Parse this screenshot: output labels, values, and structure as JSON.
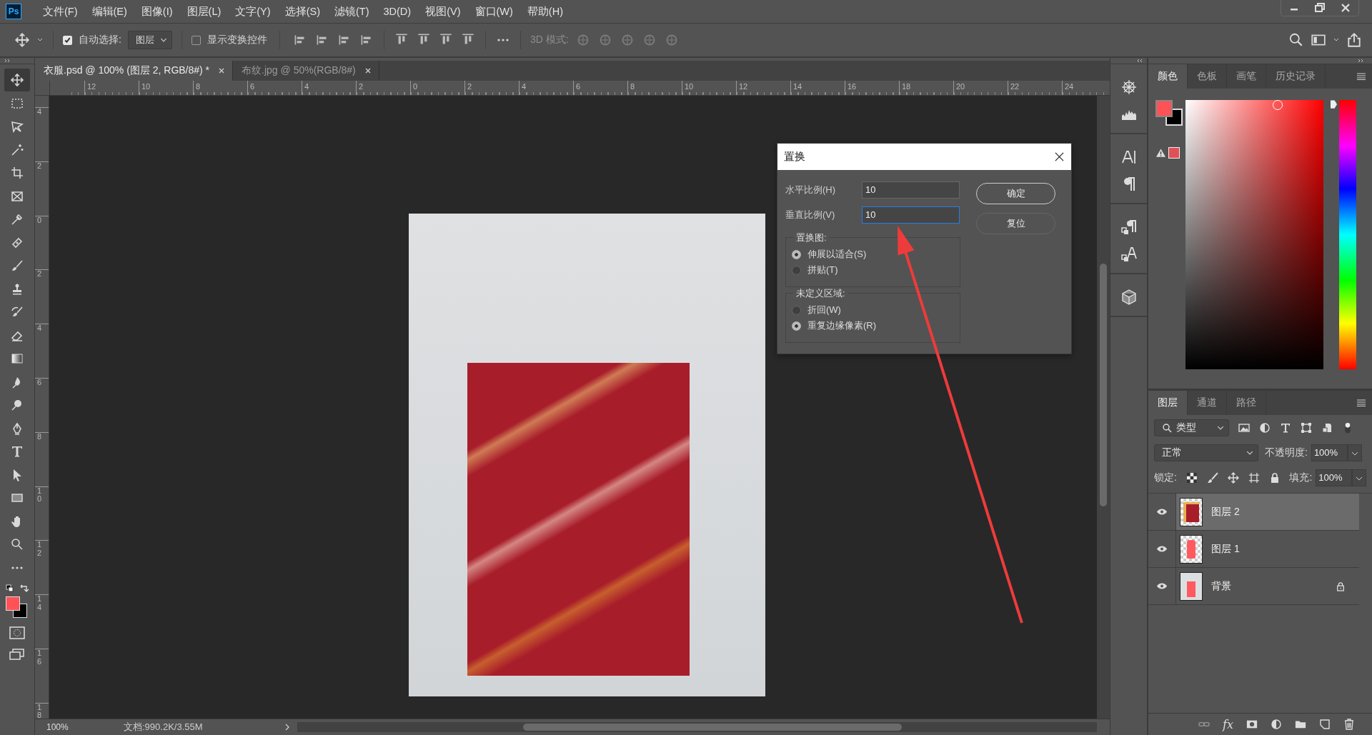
{
  "app_logo": "Ps",
  "menu": [
    "文件(F)",
    "编辑(E)",
    "图像(I)",
    "图层(L)",
    "文字(Y)",
    "选择(S)",
    "滤镜(T)",
    "3D(D)",
    "视图(V)",
    "窗口(W)",
    "帮助(H)"
  ],
  "options_bar": {
    "auto_select": {
      "label": "自动选择:",
      "checked": true
    },
    "target": "图层",
    "show_transform": {
      "label": "显示变换控件",
      "checked": false
    },
    "mode_label": "3D 模式:"
  },
  "doc_tabs": [
    {
      "label": "衣服.psd @ 100% (图层 2, RGB/8#) *",
      "selected": true
    },
    {
      "label": "布纹.jpg @ 50%(RGB/8#)",
      "selected": false
    }
  ],
  "tools": [
    {
      "kind": "move",
      "selected": true
    },
    {
      "kind": "marquee",
      "selected": false
    },
    {
      "kind": "lasso",
      "selected": false
    },
    {
      "kind": "wand",
      "selected": false
    },
    {
      "kind": "crop",
      "selected": false
    },
    {
      "kind": "frame",
      "selected": false
    },
    {
      "kind": "eyedropper",
      "selected": false
    },
    {
      "kind": "healing",
      "selected": false
    },
    {
      "kind": "brush",
      "selected": false
    },
    {
      "kind": "stamp",
      "selected": false
    },
    {
      "kind": "history",
      "selected": false
    },
    {
      "kind": "eraser",
      "selected": false
    },
    {
      "kind": "gradient",
      "selected": false
    },
    {
      "kind": "blur",
      "selected": false
    },
    {
      "kind": "dodge",
      "selected": false
    },
    {
      "kind": "pen",
      "selected": false
    },
    {
      "kind": "type",
      "selected": false
    },
    {
      "kind": "select",
      "selected": false
    },
    {
      "kind": "rectangle",
      "selected": false
    },
    {
      "kind": "hand",
      "selected": false
    },
    {
      "kind": "zoom",
      "selected": false
    },
    {
      "kind": "more",
      "selected": false
    }
  ],
  "rulers": {
    "horizontal": [
      "12",
      "10",
      "8",
      "6",
      "4",
      "2",
      "0",
      "2",
      "4",
      "6",
      "8",
      "10",
      "12",
      "14",
      "16",
      "18",
      "20",
      "22",
      "24"
    ],
    "vertical": [
      "4",
      "2",
      "0",
      "2",
      "4",
      "6",
      "8",
      "10",
      "12",
      "14",
      "16",
      "18"
    ]
  },
  "dialog": {
    "title": "置换",
    "fields": [
      {
        "label": "水平比例(H)",
        "value": "10",
        "focused": false
      },
      {
        "label": "垂直比例(V)",
        "value": "10",
        "focused": true
      }
    ],
    "groups": [
      {
        "title": "置换图:",
        "options": [
          {
            "label": "伸展以适合(S)",
            "selected": true
          },
          {
            "label": "拼贴(T)",
            "selected": false
          }
        ]
      },
      {
        "title": "未定义区域:",
        "options": [
          {
            "label": "折回(W)",
            "selected": false
          },
          {
            "label": "重复边缘像素(R)",
            "selected": true
          }
        ]
      }
    ],
    "buttons": [
      {
        "label": "确定",
        "default": true
      },
      {
        "label": "复位",
        "default": false
      }
    ]
  },
  "color_panel": {
    "hue": {
      "level": 0.03
    },
    "tabs": [
      {
        "label": "颜色",
        "selected": true
      },
      {
        "label": "色板",
        "selected": false
      },
      {
        "label": "画笔",
        "selected": false
      },
      {
        "label": "历史记录",
        "selected": false
      }
    ]
  },
  "layers_panel": {
    "tabs": [
      {
        "label": "图层",
        "selected": true
      },
      {
        "label": "通道",
        "selected": false
      },
      {
        "label": "路径",
        "selected": false
      }
    ],
    "filter": "类型",
    "blend_mode": "正常",
    "opacity_label": "不透明度:",
    "opacity": "100%",
    "lock_label": "锁定:",
    "fill_label": "填充:",
    "fill": "100%",
    "layers": [
      {
        "name": "图层 2",
        "kind": "pattern",
        "visible": true,
        "locked": false,
        "selected": true
      },
      {
        "name": "图层 1",
        "kind": "dress",
        "visible": true,
        "locked": false,
        "selected": false
      },
      {
        "name": "背景",
        "kind": "photo",
        "visible": true,
        "locked": true,
        "selected": false
      }
    ],
    "fx_label": "fx"
  },
  "status_bar": {
    "zoom": "100%",
    "doc_info": "文档:990.2K/3.55M"
  }
}
